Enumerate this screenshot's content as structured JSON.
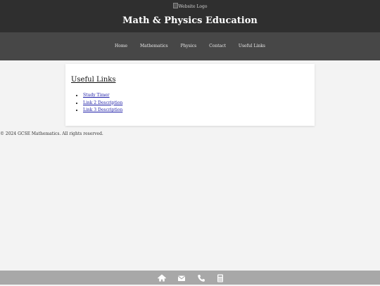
{
  "header": {
    "logo_alt": "Website Logo",
    "title": "Math & Physics Education"
  },
  "nav": {
    "items": [
      {
        "label": "Home"
      },
      {
        "label": "Mathematics"
      },
      {
        "label": "Physics"
      },
      {
        "label": "Contact"
      },
      {
        "label": "Useful Links"
      }
    ]
  },
  "main": {
    "heading": "Useful Links",
    "links": [
      {
        "label": "Study Timer"
      },
      {
        "label": "Link 2 Description"
      },
      {
        "label": "Link 3 Description"
      }
    ]
  },
  "footer": {
    "copyright": "© 2024 GCSE Mathematics. All rights reserved."
  },
  "bottom_bar": {
    "icons": [
      "home-icon",
      "envelope-icon",
      "phone-icon",
      "calculator-icon"
    ]
  },
  "colors": {
    "header_bg": "#2f2f2f",
    "nav_bg": "#474747",
    "page_bg": "#f3f3f3",
    "bottom_bar_bg": "#a8a8a8",
    "link": "#1a1aa6"
  }
}
